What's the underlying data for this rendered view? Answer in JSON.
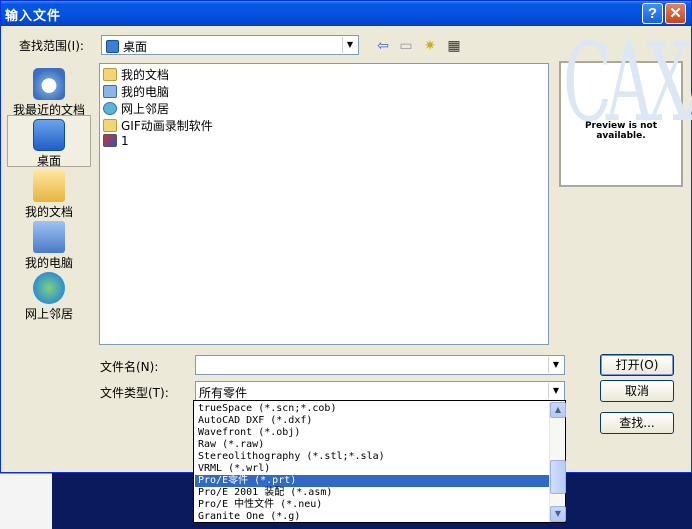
{
  "window": {
    "title": "输入文件",
    "help_glyph": "?",
    "close_glyph": "✕"
  },
  "lookin": {
    "label": "查找范围(I):",
    "value": "桌面",
    "icons": [
      "back-arrow-icon",
      "up-folder-icon",
      "new-folder-icon",
      "view-menu-icon"
    ]
  },
  "places": [
    {
      "label": "我最近的文档",
      "icon": "recent-documents-icon"
    },
    {
      "label": "桌面",
      "icon": "desktop-icon",
      "selected": true
    },
    {
      "label": "我的文档",
      "icon": "my-documents-icon"
    },
    {
      "label": "我的电脑",
      "icon": "my-computer-icon"
    },
    {
      "label": "网上邻居",
      "icon": "network-places-icon"
    }
  ],
  "files": [
    {
      "name": "我的文档",
      "icon": "folder-icon"
    },
    {
      "name": "我的电脑",
      "icon": "computer-icon"
    },
    {
      "name": "网上邻居",
      "icon": "network-icon"
    },
    {
      "name": "GIF动画录制软件",
      "icon": "folder-icon"
    },
    {
      "name": "1",
      "icon": "part-file-icon"
    }
  ],
  "preview": {
    "watermark": "CAXA",
    "message": "Preview is not available."
  },
  "filename": {
    "label": "文件名(N):",
    "value": ""
  },
  "filetype": {
    "label": "文件类型(T):",
    "value": "所有零件",
    "options": [
      "trueSpace (*.scn;*.cob)",
      "AutoCAD DXF (*.dxf)",
      "Wavefront (*.obj)",
      "Raw  (*.raw)",
      "Stereolithography (*.stl;*.sla)",
      "VRML (*.wrl)",
      "Pro/E零件 (*.prt)",
      "Pro/E 2001 装配 (*.asm)",
      "Pro/E 中性文件 (*.neu)",
      "Granite One (*.g)"
    ],
    "selected_index": 6
  },
  "buttons": {
    "open": "打开(O)",
    "cancel": "取消",
    "find": "查找..."
  },
  "colors": {
    "title_bar": "#0453e0",
    "selection": "#316ac5",
    "desktop": "#0a1a5c"
  }
}
